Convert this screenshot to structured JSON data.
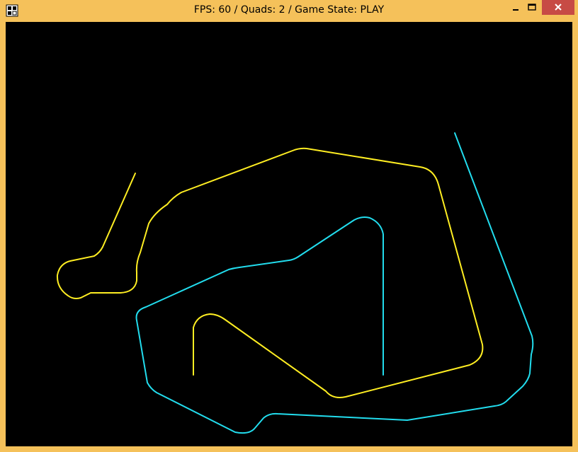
{
  "window": {
    "title": "FPS: 60 / Quads: 2 / Game State: PLAY",
    "frame_color": "#f5c15a",
    "close_color": "#c74b45"
  },
  "icons": {
    "app": "app-icon",
    "minimize": "minimize-icon",
    "maximize": "maximize-icon",
    "close": "close-icon"
  },
  "game": {
    "background": "#000000",
    "track_colors": {
      "yellow": "#ffee22",
      "cyan": "#22ddee"
    }
  }
}
